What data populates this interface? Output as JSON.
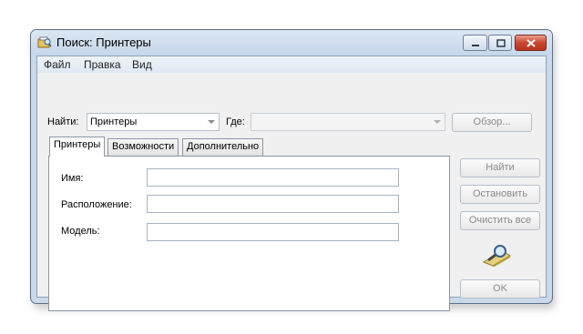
{
  "window": {
    "title": "Поиск: Принтеры"
  },
  "menu": {
    "items": [
      "Файл",
      "Правка",
      "Вид"
    ]
  },
  "search_bar": {
    "find_label": "Найти:",
    "find_value": "Принтеры",
    "where_label": "Где:",
    "where_value": "",
    "browse_label": "Обзор..."
  },
  "tabs": [
    "Принтеры",
    "Возможности",
    "Дополнительно"
  ],
  "form": {
    "name_label": "Имя:",
    "location_label": "Расположение:",
    "model_label": "Модель:"
  },
  "actions": {
    "find_label": "Найти",
    "stop_label": "Остановить",
    "clear_label": "Очистить все",
    "ok_label": "OK"
  },
  "icons": {
    "app": "search-app-icon",
    "search": "magnifier-icon"
  }
}
